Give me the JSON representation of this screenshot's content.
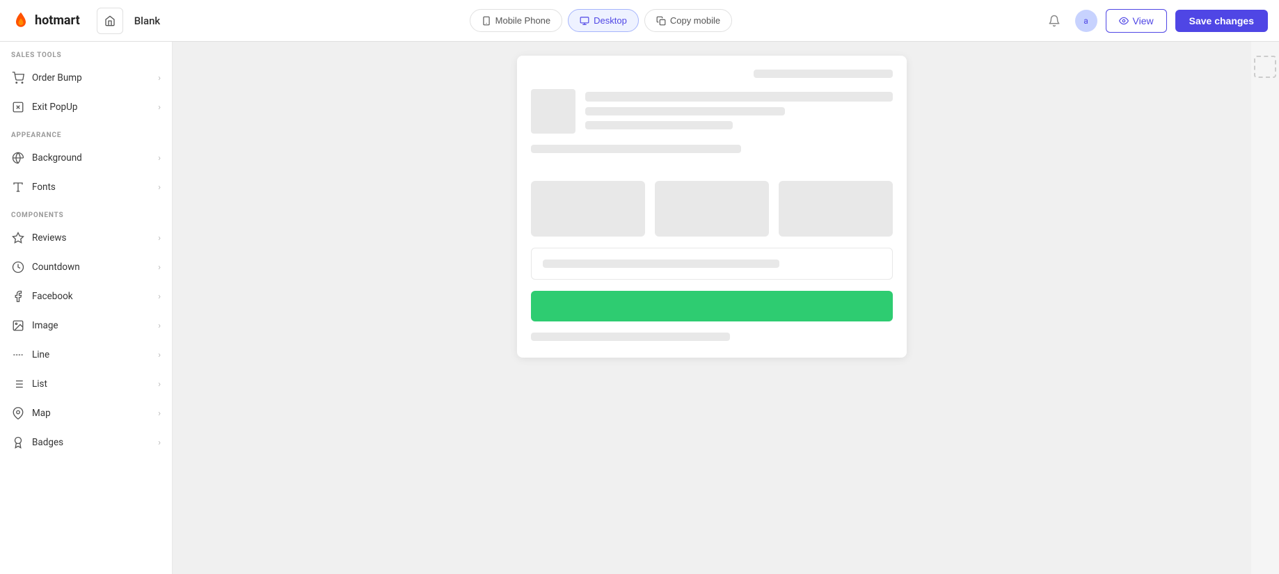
{
  "header": {
    "logo_text": "hotmart",
    "home_label": "Home",
    "page_title": "Blank",
    "devices": {
      "mobile_label": "Mobile Phone",
      "desktop_label": "Desktop",
      "copy_mobile_label": "Copy mobile"
    },
    "view_label": "View",
    "save_label": "Save changes"
  },
  "sidebar": {
    "sections": [
      {
        "label": "SALES TOOLS",
        "items": [
          {
            "id": "order-bump",
            "icon": "🛒",
            "label": "Order Bump"
          },
          {
            "id": "exit-popup",
            "icon": "🚪",
            "label": "Exit PopUp"
          }
        ]
      },
      {
        "label": "APPEARANCE",
        "items": [
          {
            "id": "background",
            "icon": "🎨",
            "label": "Background"
          },
          {
            "id": "fonts",
            "icon": "Aa",
            "label": "Fonts"
          }
        ]
      },
      {
        "label": "COMPONENTS",
        "items": [
          {
            "id": "reviews",
            "icon": "⭐",
            "label": "Reviews"
          },
          {
            "id": "countdown",
            "icon": "⏱",
            "label": "Countdown"
          },
          {
            "id": "facebook",
            "icon": "📘",
            "label": "Facebook"
          },
          {
            "id": "image",
            "icon": "🖼",
            "label": "Image"
          },
          {
            "id": "line",
            "icon": "➖",
            "label": "Line"
          },
          {
            "id": "list",
            "icon": "📋",
            "label": "List"
          },
          {
            "id": "map",
            "icon": "📍",
            "label": "Map"
          },
          {
            "id": "badges",
            "icon": "🏅",
            "label": "Badges"
          }
        ]
      }
    ]
  },
  "canvas": {
    "green_button_color": "#2ecc71"
  }
}
